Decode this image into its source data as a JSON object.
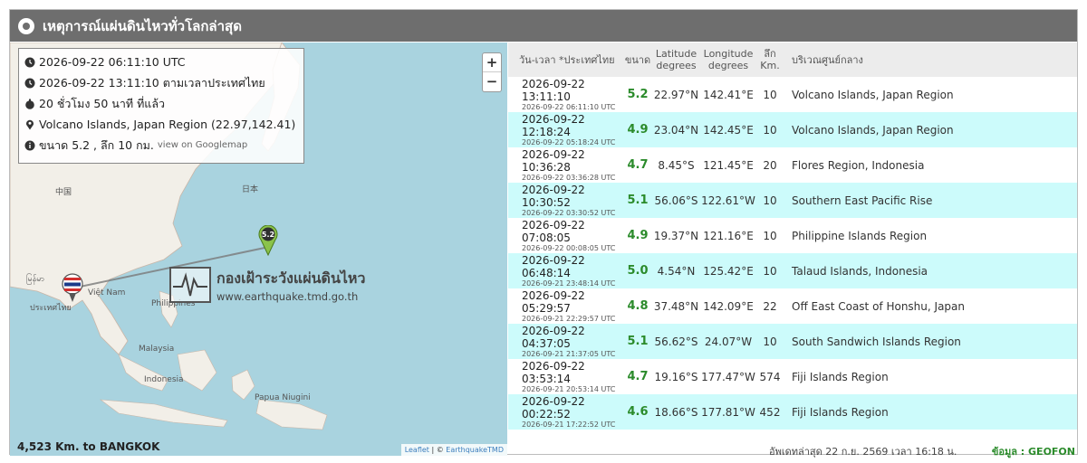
{
  "header": {
    "title": "เหตุการณ์แผ่นดินไหวทั่วโลกล่าสุด"
  },
  "info": {
    "utc": "2026-09-22 06:11:10 UTC",
    "local": "2026-09-22 13:11:10 ตามเวลาประเทศไทย",
    "ago": "20 ชั่วโมง 50 นาที ที่แล้ว",
    "location": "Volcano Islands, Japan Region (22.97,142.41)",
    "magnitude_depth": "ขนาด 5.2 , ลึก 10 กม.",
    "googlemap_link": "view on Googlemap"
  },
  "map": {
    "zoom_in": "+",
    "zoom_out": "−",
    "marker_label": "5.2",
    "distance": "4,523 Km. to BANGKOK",
    "attribution_leaflet": "Leaflet",
    "attribution_sep": " | © ",
    "attribution_owner": "EarthquakeTMD",
    "logo_title": "กองเฝ้าระวังแผ่นดินไหว",
    "logo_url": "www.earthquake.tmd.go.th",
    "labels": {
      "china": "中国",
      "japan": "日本",
      "myanmar": "မြန်မာ",
      "thailand": "ประเทศไทย",
      "vietnam": "Việt Nam",
      "philippines": "Philippines",
      "malaysia": "Malaysia",
      "indonesia": "Indonesia",
      "papua": "Papua Niugini"
    }
  },
  "table": {
    "columns": {
      "time": "วัน-เวลา *ประเทศไทย",
      "mag": "ขนาด",
      "lat": "Latitude degrees",
      "lon": "Longitude degrees",
      "depth": "ลึก Km.",
      "region": "บริเวณศูนย์กลาง"
    },
    "rows": [
      {
        "local": "2026-09-22 13:11:10",
        "utc": "2026-09-22 06:11:10 UTC",
        "mag": "5.2",
        "lat": "22.97°N",
        "lon": "142.41°E",
        "depth": "10",
        "region": "Volcano Islands, Japan Region"
      },
      {
        "local": "2026-09-22 12:18:24",
        "utc": "2026-09-22 05:18:24 UTC",
        "mag": "4.9",
        "lat": "23.04°N",
        "lon": "142.45°E",
        "depth": "10",
        "region": "Volcano Islands, Japan Region"
      },
      {
        "local": "2026-09-22 10:36:28",
        "utc": "2026-09-22 03:36:28 UTC",
        "mag": "4.7",
        "lat": "8.45°S",
        "lon": "121.45°E",
        "depth": "20",
        "region": "Flores Region, Indonesia"
      },
      {
        "local": "2026-09-22 10:30:52",
        "utc": "2026-09-22 03:30:52 UTC",
        "mag": "5.1",
        "lat": "56.06°S",
        "lon": "122.61°W",
        "depth": "10",
        "region": "Southern East Pacific Rise"
      },
      {
        "local": "2026-09-22 07:08:05",
        "utc": "2026-09-22 00:08:05 UTC",
        "mag": "4.9",
        "lat": "19.37°N",
        "lon": "121.16°E",
        "depth": "10",
        "region": "Philippine Islands Region"
      },
      {
        "local": "2026-09-22 06:48:14",
        "utc": "2026-09-21 23:48:14 UTC",
        "mag": "5.0",
        "lat": "4.54°N",
        "lon": "125.42°E",
        "depth": "10",
        "region": "Talaud Islands, Indonesia"
      },
      {
        "local": "2026-09-22 05:29:57",
        "utc": "2026-09-21 22:29:57 UTC",
        "mag": "4.8",
        "lat": "37.48°N",
        "lon": "142.09°E",
        "depth": "22",
        "region": "Off East Coast of Honshu, Japan"
      },
      {
        "local": "2026-09-22 04:37:05",
        "utc": "2026-09-21 21:37:05 UTC",
        "mag": "5.1",
        "lat": "56.62°S",
        "lon": "24.07°W",
        "depth": "10",
        "region": "South Sandwich Islands Region"
      },
      {
        "local": "2026-09-22 03:53:14",
        "utc": "2026-09-21 20:53:14 UTC",
        "mag": "4.7",
        "lat": "19.16°S",
        "lon": "177.47°W",
        "depth": "574",
        "region": "Fiji Islands Region"
      },
      {
        "local": "2026-09-22 00:22:52",
        "utc": "2026-09-21 17:22:52 UTC",
        "mag": "4.6",
        "lat": "18.66°S",
        "lon": "177.81°W",
        "depth": "452",
        "region": "Fiji Islands Region"
      }
    ],
    "updated": "อัพเดทล่าสุด 22 ก.ย. 2569 เวลา 16:18 น.",
    "source": "ข้อมูล : GEOFON"
  },
  "colors": {
    "header_bg": "#6e6e6e",
    "row_alt": "#ccfbfb",
    "mag_green": "#2b8b2b",
    "sea": "#a9d3df",
    "land": "#f2efe8"
  }
}
